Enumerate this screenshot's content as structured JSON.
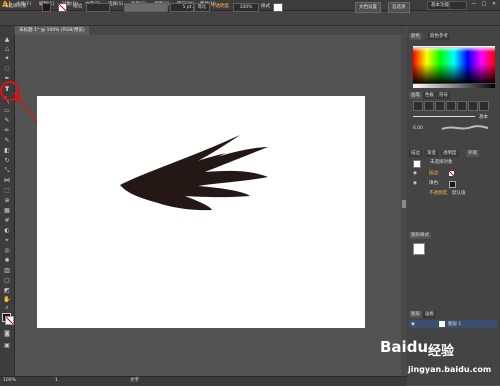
{
  "app": {
    "logo": "Ai",
    "workspace": "基本功能",
    "search_placeholder": "",
    "window_controls": [
      "—",
      "□",
      "✕"
    ]
  },
  "menu": [
    "文件(F)",
    "编辑(E)",
    "对象(O)",
    "文字(T)",
    "选择(S)",
    "效果(C)",
    "视图(V)",
    "窗口(W)",
    "帮助(H)"
  ],
  "control_bar": {
    "selection_label": "未选择对象",
    "stroke_label": "描边",
    "stroke_value": "5 pt.",
    "stroke_style": "等比",
    "opacity_label": "不透明度",
    "opacity_value": "100%",
    "style_label": "样式",
    "doc_setup": "文档设置",
    "preferences": "首选项"
  },
  "document_tab": "未标题-1* @ 100% (RGB/预览)",
  "status_bar": {
    "zoom": "100%",
    "page": "1",
    "tool_name": "文字"
  },
  "panels": {
    "color": {
      "tabs": [
        "颜色",
        "颜色参考"
      ]
    },
    "brushes": {
      "tabs": [
        "画笔",
        "色板",
        "符号"
      ],
      "basic_label": "基本",
      "stroke_size": "6.00"
    },
    "appearance": {
      "tabs": [
        "描边",
        "渐变",
        "透明度",
        "外观"
      ],
      "header": "未选择对象",
      "rows": [
        "描边:",
        "填色:",
        "不透明度:"
      ],
      "opacity_value": "默认值"
    },
    "graphic_styles": {
      "tab": "图形样式"
    },
    "layers": {
      "tabs": [
        "图层",
        "画板"
      ],
      "layer_name": "图层 1"
    }
  },
  "watermark": {
    "brand": "Baidu",
    "brand_suffix": "经验",
    "url": "jingyan.baidu.com"
  },
  "colors": {
    "accent_red": "#e01010",
    "fill": "#231815",
    "panel_bg": "#444444",
    "canvas_bg": "#535353"
  }
}
